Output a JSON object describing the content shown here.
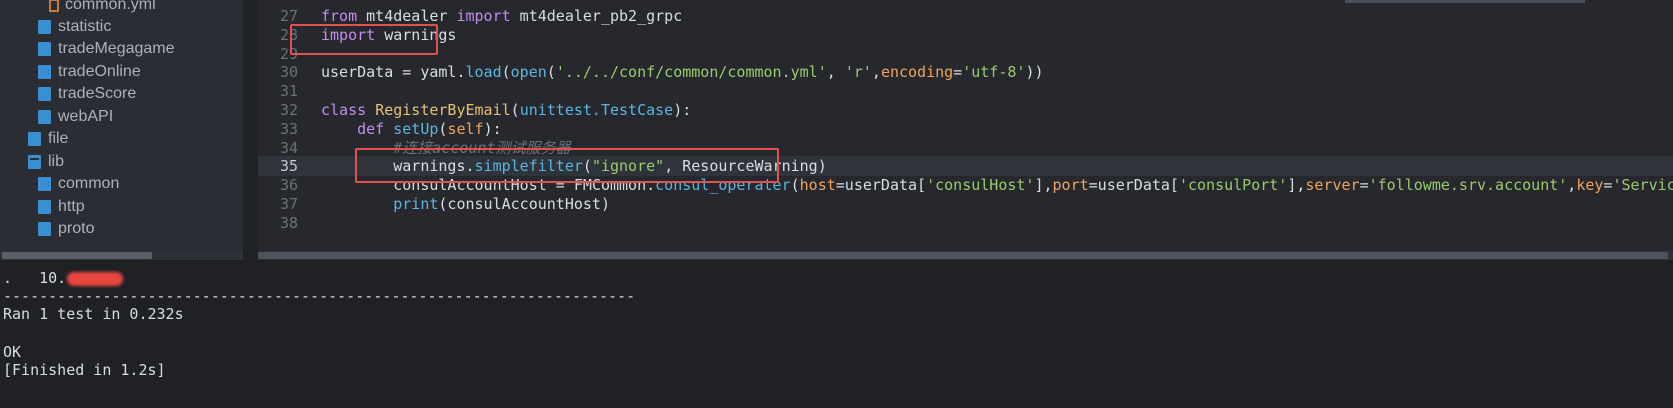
{
  "sidebar": {
    "items": [
      {
        "label": "common.yml",
        "type": "file",
        "icon": "yaml-file-icon"
      },
      {
        "label": "statistic",
        "type": "folder",
        "icon": "folder-icon"
      },
      {
        "label": "tradeMegagame",
        "type": "folder",
        "icon": "folder-icon"
      },
      {
        "label": "tradeOnline",
        "type": "folder",
        "icon": "folder-icon"
      },
      {
        "label": "tradeScore",
        "type": "folder",
        "icon": "folder-icon"
      },
      {
        "label": "webAPI",
        "type": "folder",
        "icon": "folder-icon"
      },
      {
        "label": "file",
        "type": "folder",
        "icon": "folder-icon"
      },
      {
        "label": "lib",
        "type": "folder-open",
        "icon": "folder-open-icon"
      },
      {
        "label": "common",
        "type": "folder",
        "icon": "folder-icon"
      },
      {
        "label": "http",
        "type": "folder",
        "icon": "folder-icon"
      },
      {
        "label": "proto",
        "type": "folder",
        "icon": "folder-icon"
      }
    ]
  },
  "editor": {
    "active_line": "35",
    "lines": [
      {
        "n": "27",
        "t": [
          [
            "kw",
            "from"
          ],
          [
            "plain",
            " mt4dealer "
          ],
          [
            "kw",
            "import"
          ],
          [
            "plain",
            " mt4dealer_pb2_grpc"
          ]
        ]
      },
      {
        "n": "28",
        "t": [
          [
            "kw",
            "import"
          ],
          [
            "plain",
            " warnings"
          ]
        ]
      },
      {
        "n": "29",
        "t": []
      },
      {
        "n": "30",
        "t": [
          [
            "plain",
            "userData = yaml."
          ],
          [
            "fn",
            "load"
          ],
          [
            "plain",
            "("
          ],
          [
            "fn",
            "open"
          ],
          [
            "plain",
            "("
          ],
          [
            "str",
            "'../../conf/common/common.yml'"
          ],
          [
            "plain",
            ", "
          ],
          [
            "str",
            "'r'"
          ],
          [
            "plain",
            ","
          ],
          [
            "param",
            "encoding"
          ],
          [
            "plain",
            "="
          ],
          [
            "str",
            "'utf-8'"
          ],
          [
            "plain",
            "))"
          ]
        ]
      },
      {
        "n": "31",
        "t": []
      },
      {
        "n": "32",
        "t": [
          [
            "kw",
            "class"
          ],
          [
            "plain",
            " "
          ],
          [
            "cls",
            "RegisterByEmail"
          ],
          [
            "plain",
            "("
          ],
          [
            "fn",
            "unittest.TestCase"
          ],
          [
            "plain",
            "):"
          ]
        ]
      },
      {
        "n": "33",
        "t": [
          [
            "plain",
            "    "
          ],
          [
            "kw",
            "def"
          ],
          [
            "plain",
            " "
          ],
          [
            "fn",
            "setUp"
          ],
          [
            "plain",
            "("
          ],
          [
            "param",
            "self"
          ],
          [
            "plain",
            "):"
          ]
        ]
      },
      {
        "n": "34",
        "t": [
          [
            "plain",
            "        "
          ],
          [
            "cm",
            "#连接account测试服务器"
          ]
        ]
      },
      {
        "n": "35",
        "t": [
          [
            "plain",
            "        warnings."
          ],
          [
            "fn",
            "simplefilter"
          ],
          [
            "plain",
            "("
          ],
          [
            "str",
            "\"ignore\""
          ],
          [
            "plain",
            ", ResourceWarning)"
          ]
        ]
      },
      {
        "n": "36",
        "t": [
          [
            "plain",
            "        consulAccountHost = FMCommon."
          ],
          [
            "fn",
            "consul_operater"
          ],
          [
            "plain",
            "("
          ],
          [
            "param",
            "host"
          ],
          [
            "plain",
            "=userData["
          ],
          [
            "str",
            "'consulHost'"
          ],
          [
            "plain",
            "],"
          ],
          [
            "param",
            "port"
          ],
          [
            "plain",
            "=userData["
          ],
          [
            "str",
            "'consulPort'"
          ],
          [
            "plain",
            "],"
          ],
          [
            "param",
            "server"
          ],
          [
            "plain",
            "="
          ],
          [
            "str",
            "'followme.srv.account'"
          ],
          [
            "plain",
            ","
          ],
          [
            "param",
            "key"
          ],
          [
            "plain",
            "="
          ],
          [
            "str",
            "'ServiceA"
          ]
        ]
      },
      {
        "n": "37",
        "t": [
          [
            "plain",
            "        "
          ],
          [
            "fn",
            "print"
          ],
          [
            "plain",
            "(consulAccountHost)"
          ]
        ]
      },
      {
        "n": "38",
        "t": []
      }
    ]
  },
  "console": {
    "ip_prefix": "10.",
    "dot": ".",
    "separator": "----------------------------------------------------------------------",
    "ran": "Ran 1 test in 0.232s",
    "ok": "OK",
    "finished": "[Finished in 1.2s]"
  },
  "colors": {
    "highlight_box": "#e0524d",
    "folder": "#3b8fd1",
    "redaction": "#e8473f"
  }
}
